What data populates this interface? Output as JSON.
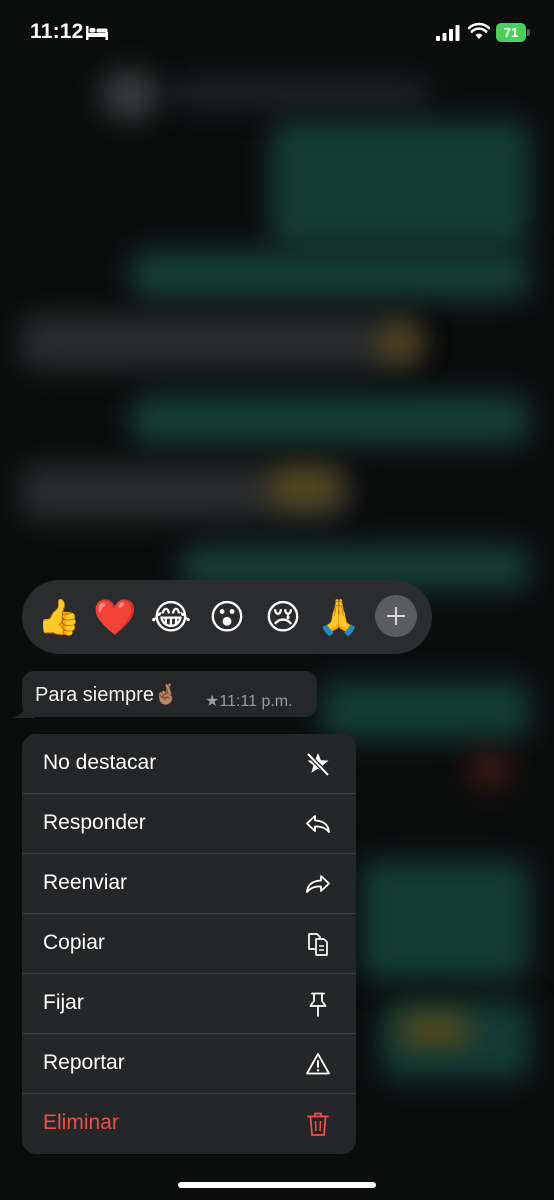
{
  "status_bar": {
    "time": "11:12",
    "battery": "71",
    "icons": [
      "bed-icon",
      "signal-icon",
      "wifi-icon",
      "battery-icon"
    ]
  },
  "reactions": {
    "items": [
      {
        "emoji": "👍",
        "name": "thumbs-up"
      },
      {
        "emoji": "❤️",
        "name": "heart"
      },
      {
        "emoji": "😂",
        "name": "tears-of-joy"
      },
      {
        "emoji": "😮",
        "name": "open-mouth"
      },
      {
        "emoji": "😢",
        "name": "crying-face"
      },
      {
        "emoji": "🙏",
        "name": "folded-hands"
      }
    ],
    "more_icon": "plus-icon"
  },
  "message": {
    "text": "Para siempre🤞🏽",
    "meta": "★11:11 p.m."
  },
  "menu": {
    "items": [
      {
        "label": "No destacar",
        "icon": "unstar-icon"
      },
      {
        "label": "Responder",
        "icon": "reply-icon"
      },
      {
        "label": "Reenviar",
        "icon": "forward-icon"
      },
      {
        "label": "Copiar",
        "icon": "copy-icon"
      },
      {
        "label": "Fijar",
        "icon": "pin-icon"
      },
      {
        "label": "Reportar",
        "icon": "warning-icon"
      },
      {
        "label": "Eliminar",
        "icon": "trash-icon"
      }
    ]
  },
  "colors": {
    "danger": "#ec4e4b",
    "menu_bg": "#252627",
    "bubble_bg": "#262728",
    "battery": "#49d15c"
  }
}
